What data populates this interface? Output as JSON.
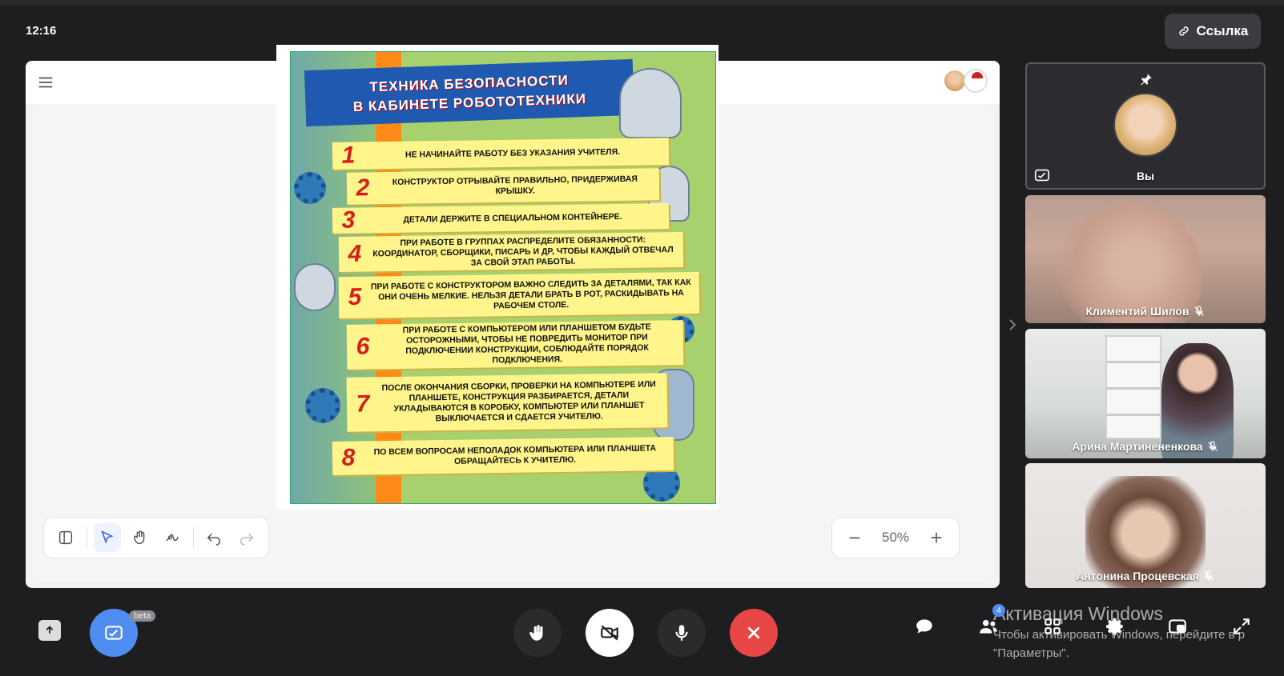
{
  "clock": "12:16",
  "link_button": "Ссылка",
  "zoom": {
    "level": "50%",
    "minus": "−",
    "plus": "+"
  },
  "poster": {
    "title_line1": "ТЕХНИКА БЕЗОПАСНОСТИ",
    "title_line2": "В КАБИНЕТЕ РОБОТОТЕХНИКИ",
    "rules": [
      {
        "num": "1",
        "text": "НЕ НАЧИНАЙТЕ РАБОТУ БЕЗ УКАЗАНИЯ УЧИТЕЛЯ."
      },
      {
        "num": "2",
        "text": "КОНСТРУКТОР ОТРЫВАЙТЕ ПРАВИЛЬНО, ПРИДЕРЖИВАЯ КРЫШКУ."
      },
      {
        "num": "3",
        "text": "ДЕТАЛИ ДЕРЖИТЕ В СПЕЦИАЛЬНОМ КОНТЕЙНЕРЕ."
      },
      {
        "num": "4",
        "text": "ПРИ РАБОТЕ В ГРУППАХ РАСПРЕДЕЛИТЕ ОБЯЗАННОСТИ: КООРДИНАТОР, СБОРЩИКИ, ПИСАРЬ И ДР, ЧТОБЫ КАЖДЫЙ ОТВЕЧАЛ ЗА СВОЙ ЭТАП РАБОТЫ."
      },
      {
        "num": "5",
        "text": "ПРИ РАБОТЕ С КОНСТРУКТОРОМ ВАЖНО СЛЕДИТЬ ЗА ДЕТАЛЯМИ, ТАК КАК ОНИ ОЧЕНЬ МЕЛКИЕ. НЕЛЬЗЯ ДЕТАЛИ БРАТЬ В РОТ, РАСКИДЫВАТЬ НА РАБОЧЕМ СТОЛЕ."
      },
      {
        "num": "6",
        "text": "ПРИ РАБОТЕ С КОМПЬЮТЕРОМ ИЛИ ПЛАНШЕТОМ БУДЬТЕ ОСТОРОЖНЫМИ, ЧТОБЫ НЕ ПОВРЕДИТЬ МОНИТОР ПРИ ПОДКЛЮЧЕНИИ КОНСТРУКЦИИ, СОБЛЮДАЙТЕ ПОРЯДОК ПОДКЛЮЧЕНИЯ."
      },
      {
        "num": "7",
        "text": "ПОСЛЕ ОКОНЧАНИЯ СБОРКИ, ПРОВЕРКИ НА КОМПЬЮТЕРЕ ИЛИ ПЛАНШЕТЕ, КОНСТРУКЦИЯ РАЗБИРАЕТСЯ, ДЕТАЛИ УКЛАДЫВАЮТСЯ В КОРОБКУ, КОМПЬЮТЕР ИЛИ ПЛАНШЕТ ВЫКЛЮЧАЕТСЯ И СДАЕТСЯ УЧИТЕЛЮ."
      },
      {
        "num": "8",
        "text": "ПО ВСЕМ ВОПРОСАМ НЕПОЛАДОК КОМПЬЮТЕРА ИЛИ ПЛАНШЕТА ОБРАЩАЙТЕСЬ К УЧИТЕЛЮ."
      }
    ]
  },
  "participants": [
    {
      "name": "Вы",
      "muted": false
    },
    {
      "name": "Климентий Шилов",
      "muted": true
    },
    {
      "name": "Арина Мартинененкова",
      "muted": true
    },
    {
      "name": "Антонина Процевская",
      "muted": true
    }
  ],
  "beta_label": "beta",
  "participants_badge": "4",
  "windows_watermark": {
    "title": "Активация Windows",
    "line1": "Чтобы активировать Windows, перейдите в р",
    "line2": "\"Параметры\"."
  },
  "colors": {
    "end_call": "#e94646",
    "accent": "#4f8ef0",
    "active_tool": "#3a5bd8"
  }
}
